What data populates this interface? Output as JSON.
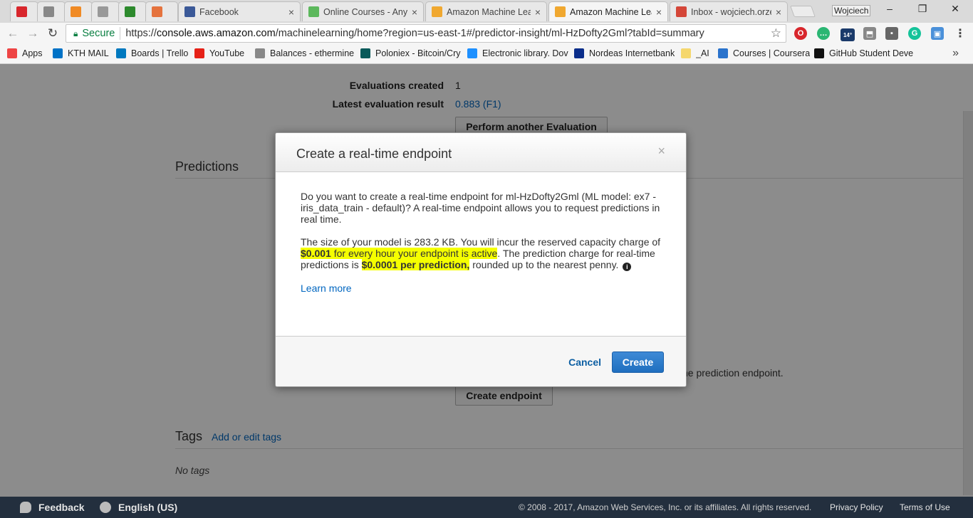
{
  "browser": {
    "tabs": [
      {
        "label": "",
        "icon": "opera-icon",
        "color": "#d8262c"
      },
      {
        "label": "",
        "icon": "cursor-icon",
        "color": "#888888"
      },
      {
        "label": "",
        "icon": "chevron-icon",
        "color": "#f08a24"
      },
      {
        "label": "",
        "icon": "document-icon",
        "color": "#999999"
      },
      {
        "label": "",
        "icon": "app-icon",
        "color": "#2d8a2d"
      },
      {
        "label": "",
        "icon": "grid-icon",
        "color": "#e5733e"
      },
      {
        "label": "Facebook",
        "icon": "facebook-icon",
        "color": "#3b5998"
      },
      {
        "label": "Online Courses - Any",
        "icon": "udemy-icon",
        "color": "#5cb85c"
      },
      {
        "label": "Amazon Machine Lea",
        "icon": "aws-box-icon",
        "color": "#f0a830"
      },
      {
        "label": "Amazon Machine Lea",
        "icon": "aws-box-icon",
        "color": "#f0a830"
      },
      {
        "label": "Inbox - wojciech.orze",
        "icon": "gmail-icon",
        "color": "#d44638"
      }
    ],
    "profile_name": "Wojciech",
    "secure_label": "Secure",
    "url_scheme": "https://",
    "url_host": "console.aws.amazon.com",
    "url_path": "/machinelearning/home?region=us-east-1#/predictor-insight/ml-HzDofty2Gml?tabId=summary",
    "weather_badge": "14°",
    "bookmarks": [
      {
        "label": "Apps",
        "icon": "apps-grid-icon",
        "color": "#e44"
      },
      {
        "label": "KTH MAIL",
        "icon": "outlook-icon",
        "color": "#0072c6"
      },
      {
        "label": "Boards | Trello",
        "icon": "trello-icon",
        "color": "#0079bf"
      },
      {
        "label": "YouTube",
        "icon": "youtube-icon",
        "color": "#e62117"
      },
      {
        "label": "Balances - ethermine",
        "icon": "cursor-icon",
        "color": "#888888"
      },
      {
        "label": "Poloniex - Bitcoin/Cry",
        "icon": "poloniex-icon",
        "color": "#0a5a5a"
      },
      {
        "label": "Electronic library. Dov",
        "icon": "library-icon",
        "color": "#1e90ff"
      },
      {
        "label": "Nordeas Internetbank",
        "icon": "nordea-icon",
        "color": "#0a2d8a"
      },
      {
        "label": "_AI",
        "icon": "folder-icon",
        "color": "#f5d76e"
      },
      {
        "label": "Courses | Coursera",
        "icon": "coursera-icon",
        "color": "#2a73cc"
      },
      {
        "label": "GitHub Student Deve",
        "icon": "github-icon",
        "color": "#111111"
      }
    ]
  },
  "page": {
    "evaluations_created_label": "Evaluations created",
    "evaluations_created_value": "1",
    "latest_eval_label": "Latest evaluation result",
    "latest_eval_value": "0.883 (F1)",
    "perform_eval_button": "Perform another Evaluation",
    "predictions_title": "Predictions",
    "endpoint_text_fragment": "he prediction endpoint.",
    "create_endpoint_button": "Create endpoint",
    "tags_title": "Tags",
    "tags_link": "Add or edit tags",
    "no_tags": "No tags"
  },
  "footer": {
    "feedback": "Feedback",
    "language": "English (US)",
    "copyright": "© 2008 - 2017, Amazon Web Services, Inc. or its affiliates. All rights reserved.",
    "privacy": "Privacy Policy",
    "terms": "Terms of Use"
  },
  "modal": {
    "title": "Create a real-time endpoint",
    "close_symbol": "×",
    "para1": "Do you want to create a real-time endpoint for ml-HzDofty2Gml (ML model: ex7 - iris_data_train - default)? A real-time endpoint allows you to request predictions in real time.",
    "para2_a": "The size of your model is 283.2 KB. You will incur the reserved capacity charge of ",
    "para2_price_hour": "$0.001",
    "para2_b": " for every hour your endpoint is active",
    "para2_c": ". The prediction charge for real-time predictions is ",
    "para2_price_pred": "$0.0001 per prediction,",
    "para2_d": " rounded up to the nearest penny.",
    "learn_more": "Learn more",
    "cancel": "Cancel",
    "create": "Create"
  }
}
